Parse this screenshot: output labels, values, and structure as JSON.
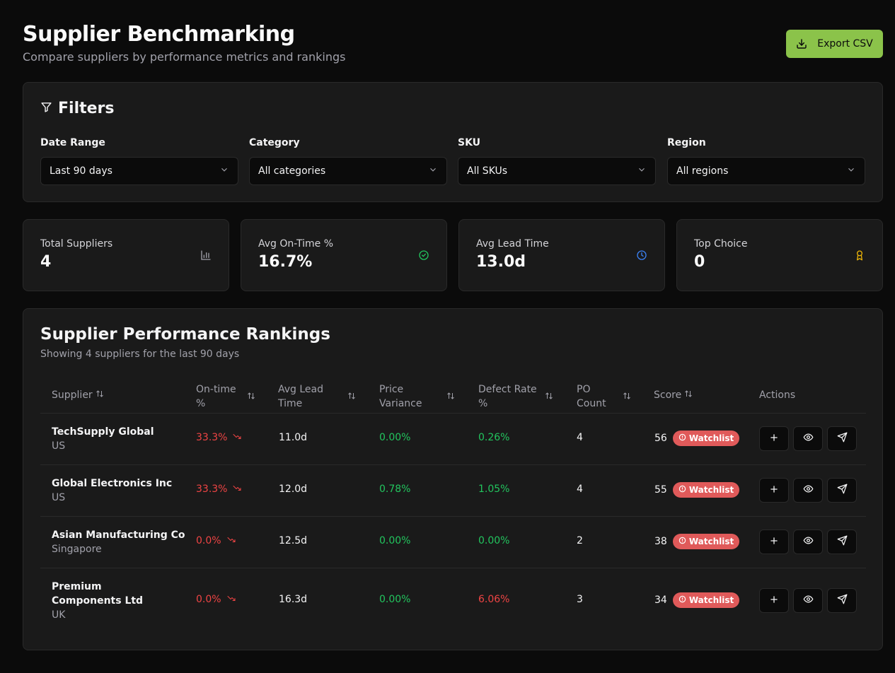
{
  "header": {
    "title": "Supplier Benchmarking",
    "subtitle": "Compare suppliers by performance metrics and rankings",
    "export_label": "Export CSV"
  },
  "filters": {
    "title": "Filters",
    "groups": [
      {
        "label": "Date Range",
        "value": "Last 90 days"
      },
      {
        "label": "Category",
        "value": "All categories"
      },
      {
        "label": "SKU",
        "value": "All SKUs"
      },
      {
        "label": "Region",
        "value": "All regions"
      }
    ]
  },
  "stats": [
    {
      "label": "Total Suppliers",
      "value": "4",
      "icon": "bar-chart-icon",
      "color": "#a1a1aa"
    },
    {
      "label": "Avg On-Time %",
      "value": "16.7%",
      "icon": "check-circle-icon",
      "color": "#22c55e"
    },
    {
      "label": "Avg Lead Time",
      "value": "13.0d",
      "icon": "clock-icon",
      "color": "#3b82f6"
    },
    {
      "label": "Top Choice",
      "value": "0",
      "icon": "award-icon",
      "color": "#eab308"
    }
  ],
  "rankings": {
    "title": "Supplier Performance Rankings",
    "subtitle": "Showing 4 suppliers for the last 90 days",
    "columns": {
      "supplier": "Supplier",
      "ontime_1": "On-time",
      "ontime_2": "%",
      "lead_1": "Avg Lead",
      "lead_2": "Time",
      "price_1": "Price",
      "price_2": "Variance",
      "defect_1": "Defect Rate",
      "defect_2": "%",
      "po_1": "PO",
      "po_2": "Count",
      "score": "Score",
      "actions": "Actions"
    },
    "badge_label": "Watchlist",
    "rows": [
      {
        "name": "TechSupply Global",
        "region": "US",
        "ontime": "33.3%",
        "lead": "11.0d",
        "price": "0.00%",
        "defect": "0.26%",
        "po": "4",
        "score": "56"
      },
      {
        "name": "Global Electronics Inc",
        "region": "US",
        "ontime": "33.3%",
        "lead": "12.0d",
        "price": "0.78%",
        "defect": "1.05%",
        "po": "4",
        "score": "55"
      },
      {
        "name": "Asian Manufacturing Co",
        "region": "Singapore",
        "ontime": "0.0%",
        "lead": "12.5d",
        "price": "0.00%",
        "defect": "0.00%",
        "po": "2",
        "score": "38"
      },
      {
        "name": "Premium Components Ltd",
        "region": "UK",
        "ontime": "0.0%",
        "lead": "16.3d",
        "price": "0.00%",
        "defect": "6.06%",
        "po": "3",
        "score": "34"
      }
    ]
  },
  "colors": {
    "accent": "#8bc34a",
    "danger": "#ef4444",
    "success": "#22c55e",
    "badge": "#e05a5a"
  }
}
